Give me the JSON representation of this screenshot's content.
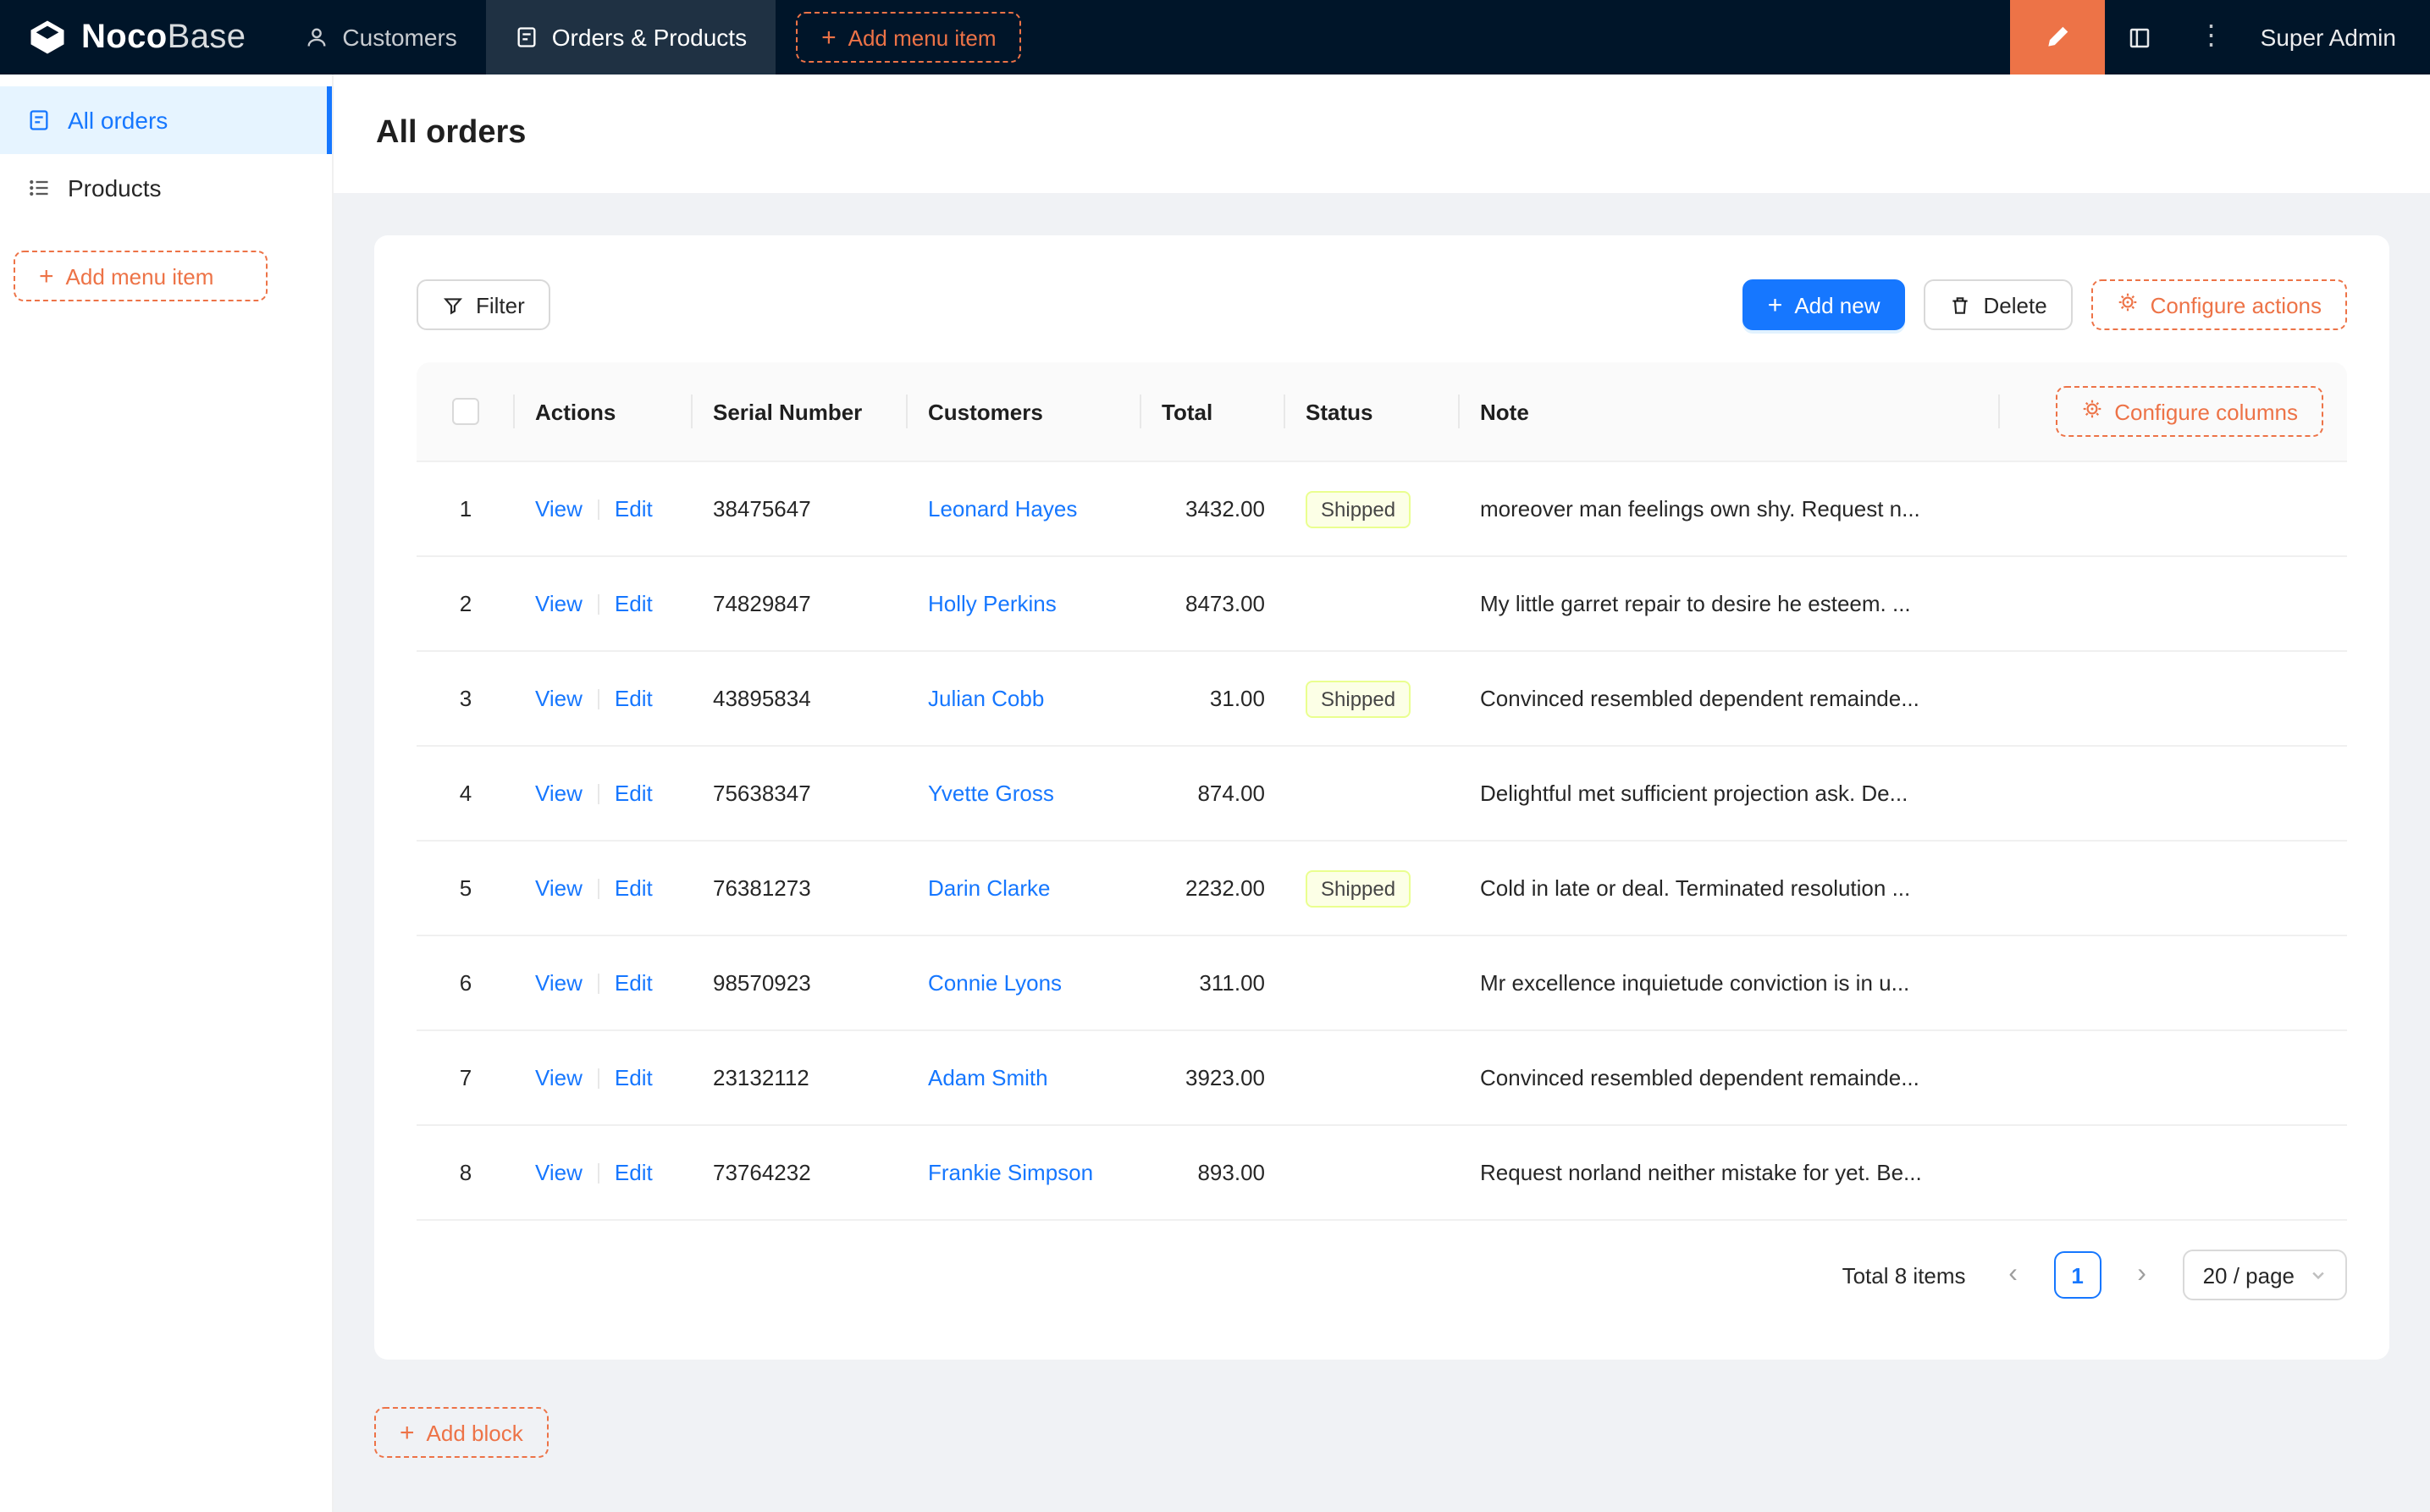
{
  "colors": {
    "accent": "#ED7347",
    "primary": "#1677FF",
    "topbar-bg": "#001529",
    "sidebar-active-bg": "#E6F4FF",
    "status-shipped-bg": "#FCFFE6",
    "status-shipped-border": "#EAFF8F",
    "status-shipped-text": "#454545"
  },
  "icons": {
    "plus": "+",
    "more": "⋮",
    "prev": "‹",
    "next": "›"
  },
  "topbar": {
    "logo_primary": "Noco",
    "logo_secondary": "Base",
    "nav": [
      {
        "label": "Customers"
      },
      {
        "label": "Orders & Products"
      }
    ],
    "add_menu_item_label": "Add menu item",
    "user": "Super Admin"
  },
  "sidebar": {
    "items": [
      {
        "label": "All orders"
      },
      {
        "label": "Products"
      }
    ],
    "add_menu_item_label": "Add menu item"
  },
  "page": {
    "title": "All orders"
  },
  "toolbar": {
    "filter_label": "Filter",
    "add_new_label": "Add new",
    "delete_label": "Delete",
    "configure_actions_label": "Configure actions"
  },
  "table": {
    "configure_columns_label": "Configure columns",
    "columns": [
      "Actions",
      "Serial Number",
      "Customers",
      "Total",
      "Status",
      "Note"
    ],
    "action_labels": {
      "view": "View",
      "edit": "Edit"
    },
    "rows": [
      {
        "index": "1",
        "serial": "38475647",
        "customer": "Leonard Hayes",
        "total": "3432.00",
        "status": "Shipped",
        "note": "moreover man feelings own shy. Request n..."
      },
      {
        "index": "2",
        "serial": "74829847",
        "customer": "Holly Perkins",
        "total": "8473.00",
        "status": "",
        "note": "My little garret repair to desire he esteem. ..."
      },
      {
        "index": "3",
        "serial": "43895834",
        "customer": "Julian Cobb",
        "total": "31.00",
        "status": "Shipped",
        "note": "Convinced resembled dependent remainde..."
      },
      {
        "index": "4",
        "serial": "75638347",
        "customer": "Yvette Gross",
        "total": "874.00",
        "status": "",
        "note": "Delightful met sufficient projection ask. De..."
      },
      {
        "index": "5",
        "serial": "76381273",
        "customer": "Darin Clarke",
        "total": "2232.00",
        "status": "Shipped",
        "note": "Cold in late or deal. Terminated resolution ..."
      },
      {
        "index": "6",
        "serial": "98570923",
        "customer": "Connie Lyons",
        "total": "311.00",
        "status": "",
        "note": "Mr excellence inquietude conviction is in u..."
      },
      {
        "index": "7",
        "serial": "23132112",
        "customer": "Adam Smith",
        "total": "3923.00",
        "status": "",
        "note": "Convinced resembled dependent remainde..."
      },
      {
        "index": "8",
        "serial": "73764232",
        "customer": "Frankie Simpson",
        "total": "893.00",
        "status": "",
        "note": "Request norland neither mistake for yet. Be..."
      }
    ]
  },
  "pagination": {
    "total_text": "Total 8 items",
    "current_page": "1",
    "page_size_label": "20 / page"
  },
  "add_block_label": "Add block"
}
